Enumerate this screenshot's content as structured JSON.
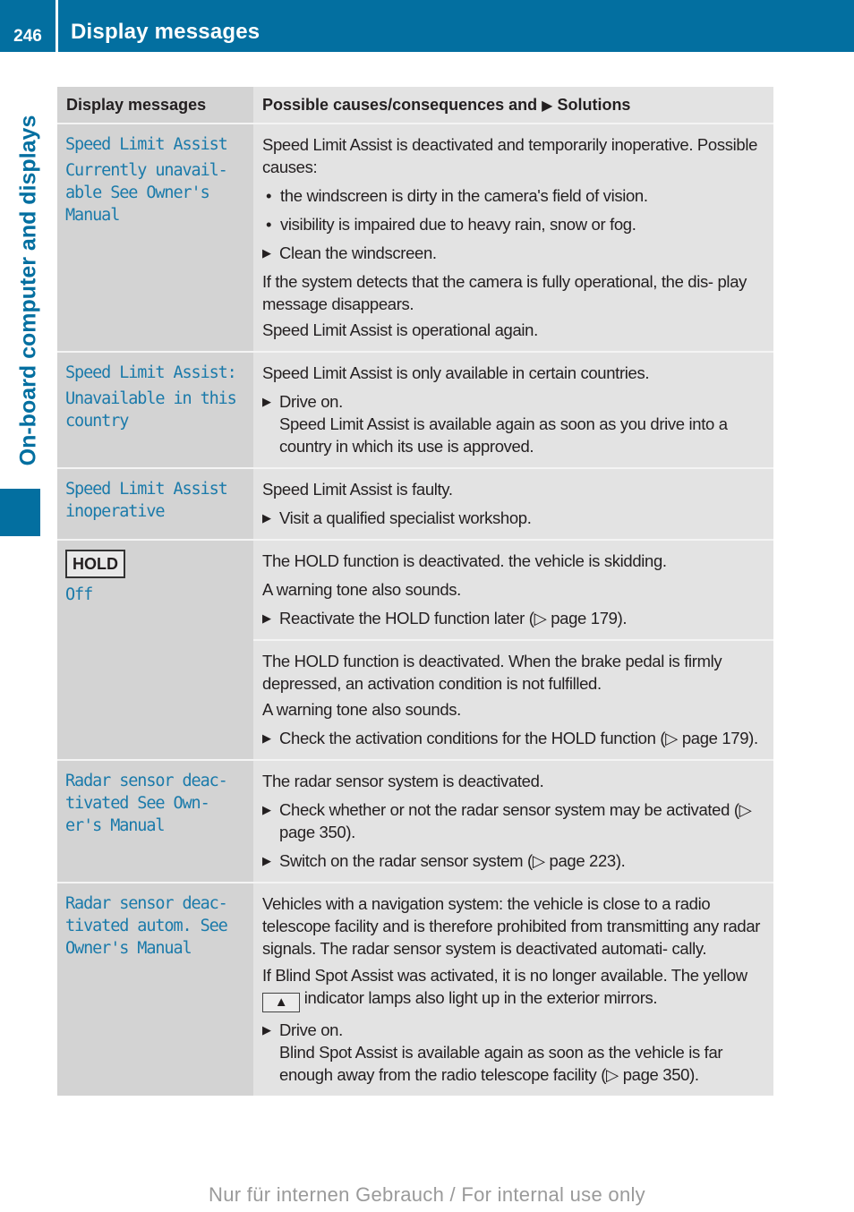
{
  "header": {
    "page_number": "246",
    "title": "Display messages"
  },
  "side_tab": {
    "label": "On-board computer and displays"
  },
  "table": {
    "col1_header": "Display messages",
    "col2_header_pre": "Possible causes/consequences and ",
    "col2_header_arrow": "▶",
    "col2_header_post": " Solutions",
    "rows": [
      {
        "message_lines": [
          "Speed Limit Assist",
          "Currently unavail‐ able See Owner's Manual"
        ],
        "intro": "Speed Limit Assist is deactivated and temporarily inoperative. Possible causes:",
        "bullets": [
          "the windscreen is dirty in the camera's field of vision.",
          "visibility is impaired due to heavy rain, snow or fog."
        ],
        "step": "Clean the windscreen.",
        "after": [
          "If the system detects that the camera is fully operational, the dis- play message disappears.",
          "Speed Limit Assist is operational again."
        ]
      },
      {
        "message_lines": [
          "Speed Limit Assist:",
          "Unavailable in this country"
        ],
        "intro": "Speed Limit Assist is only available in certain countries.",
        "step": "Drive on.",
        "step_detail": "Speed Limit Assist is available again as soon as you drive into a country in which its use is approved."
      },
      {
        "message_lines": [
          "Speed Limit Assist inoperative"
        ],
        "intro": "Speed Limit Assist is faulty.",
        "step": "Visit a qualified specialist workshop."
      },
      {
        "badge": "HOLD",
        "message_lines": [
          "Off"
        ],
        "cases": [
          {
            "lines": [
              "The HOLD function is deactivated. the vehicle is skidding.",
              "A warning tone also sounds."
            ],
            "step": "Reactivate the HOLD function later (▷ page 179)."
          },
          {
            "lines": [
              "The HOLD function is deactivated. When the brake pedal is firmly depressed, an activation condition is not fulfilled.",
              "A warning tone also sounds."
            ],
            "step": "Check the activation conditions for the HOLD function (▷ page 179)."
          }
        ]
      },
      {
        "message_lines": [
          "Radar sensor deac‐ tivated See Own‐ er's Manual"
        ],
        "intro": "The radar sensor system is deactivated.",
        "steps": [
          "Check whether or not the radar sensor system may be activated (▷ page 350).",
          "Switch on the radar sensor system (▷ page 223)."
        ]
      },
      {
        "message_lines": [
          "Radar sensor deac‐ tivated autom. See Owner's Manual"
        ],
        "intro": "Vehicles with a navigation system: the vehicle is close to a radio telescope facility and is therefore prohibited from transmitting any radar signals. The radar sensor system is deactivated automati- cally.",
        "blind_spot_pre": "If Blind Spot Assist was activated, it is no longer available. The yellow ",
        "warning_icon": "▲",
        "blind_spot_post": " indicator lamps also light up in the exterior mirrors.",
        "step": "Drive on.",
        "step_detail": "Blind Spot Assist is available again as soon as the vehicle is far enough away from the radio telescope facility (▷ page 350)."
      }
    ]
  },
  "bullet_glyph": "•",
  "step_glyph": "▶",
  "footer": {
    "watermark": "Nur für internen Gebrauch / For internal use only"
  },
  "colors": {
    "brand_blue": "#036fa0",
    "message_blue": "#1a7aaa"
  }
}
